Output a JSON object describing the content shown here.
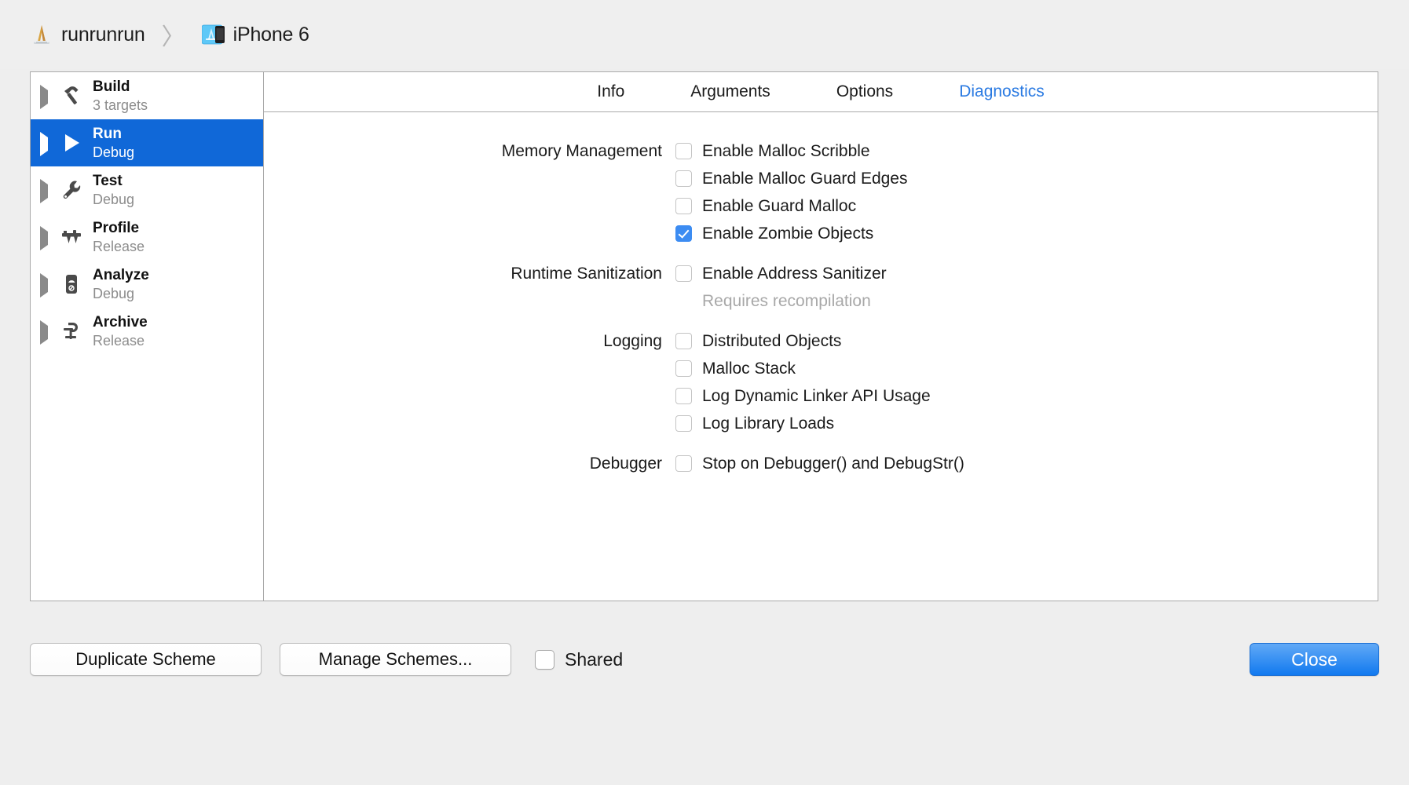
{
  "titlebar": {
    "project_icon": "xcode-app-icon",
    "project_name": "runrunrun",
    "separator": "〉",
    "destination_icon": "simulator-icon",
    "destination_name": "iPhone 6"
  },
  "sidebar": {
    "items": [
      {
        "icon": "hammer-icon",
        "title": "Build",
        "subtitle": "3 targets",
        "selected": false
      },
      {
        "icon": "play-icon",
        "title": "Run",
        "subtitle": "Debug",
        "selected": true
      },
      {
        "icon": "wrench-icon",
        "title": "Test",
        "subtitle": "Debug",
        "selected": false
      },
      {
        "icon": "caliper-icon",
        "title": "Profile",
        "subtitle": "Release",
        "selected": false
      },
      {
        "icon": "gauge-icon",
        "title": "Analyze",
        "subtitle": "Debug",
        "selected": false
      },
      {
        "icon": "clamp-icon",
        "title": "Archive",
        "subtitle": "Release",
        "selected": false
      }
    ]
  },
  "tabs": [
    {
      "label": "Info",
      "active": false
    },
    {
      "label": "Arguments",
      "active": false
    },
    {
      "label": "Options",
      "active": false
    },
    {
      "label": "Diagnostics",
      "active": true
    }
  ],
  "diagnostics": {
    "groups": [
      {
        "label": "Memory Management",
        "options": [
          {
            "label": "Enable Malloc Scribble",
            "checked": false
          },
          {
            "label": "Enable Malloc Guard Edges",
            "checked": false
          },
          {
            "label": "Enable Guard Malloc",
            "checked": false
          },
          {
            "label": "Enable Zombie Objects",
            "checked": true
          }
        ],
        "hint": ""
      },
      {
        "label": "Runtime Sanitization",
        "options": [
          {
            "label": "Enable Address Sanitizer",
            "checked": false
          }
        ],
        "hint": "Requires recompilation"
      },
      {
        "label": "Logging",
        "options": [
          {
            "label": "Distributed Objects",
            "checked": false
          },
          {
            "label": "Malloc Stack",
            "checked": false
          },
          {
            "label": "Log Dynamic Linker API Usage",
            "checked": false
          },
          {
            "label": "Log Library Loads",
            "checked": false
          }
        ],
        "hint": ""
      },
      {
        "label": "Debugger",
        "options": [
          {
            "label": "Stop on Debugger() and DebugStr()",
            "checked": false
          }
        ],
        "hint": ""
      }
    ]
  },
  "bottombar": {
    "duplicate_label": "Duplicate Scheme",
    "manage_label": "Manage Schemes...",
    "shared_label": "Shared",
    "shared_checked": false,
    "close_label": "Close"
  },
  "colors": {
    "selection_blue": "#1068d8",
    "tab_active_blue": "#2a7ae2",
    "checkbox_blue": "#3c8cf2",
    "close_button_blue": "#1179ef",
    "muted_text": "#8c8c8c",
    "hint_text": "#a8a8a8"
  }
}
